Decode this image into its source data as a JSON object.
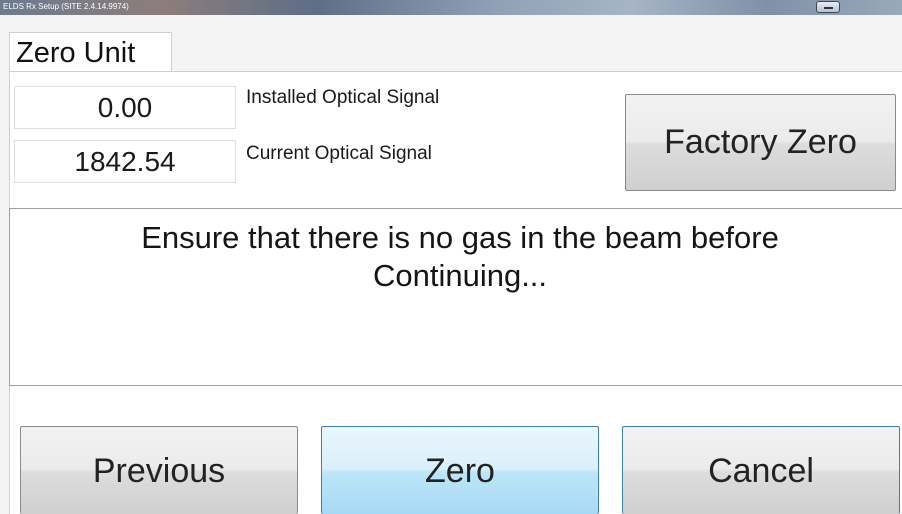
{
  "window": {
    "title": "ELDS Rx Setup (SITE 2.4.14.9974)",
    "min_icon": "minimize-icon"
  },
  "tab": {
    "label": "Zero Unit"
  },
  "signals": {
    "installed_value": "0.00",
    "installed_label": "Installed Optical Signal",
    "current_value": "1842.54",
    "current_label": "Current Optical Signal"
  },
  "buttons": {
    "factory_zero": "Factory Zero",
    "previous": "Previous",
    "zero": "Zero",
    "cancel": "Cancel"
  },
  "message": {
    "line1": "Ensure that there is no gas in the beam before",
    "line2": "Continuing..."
  },
  "colors": {
    "accent_border": "#3c7fb1",
    "selected_button": "#a7d9f5"
  }
}
